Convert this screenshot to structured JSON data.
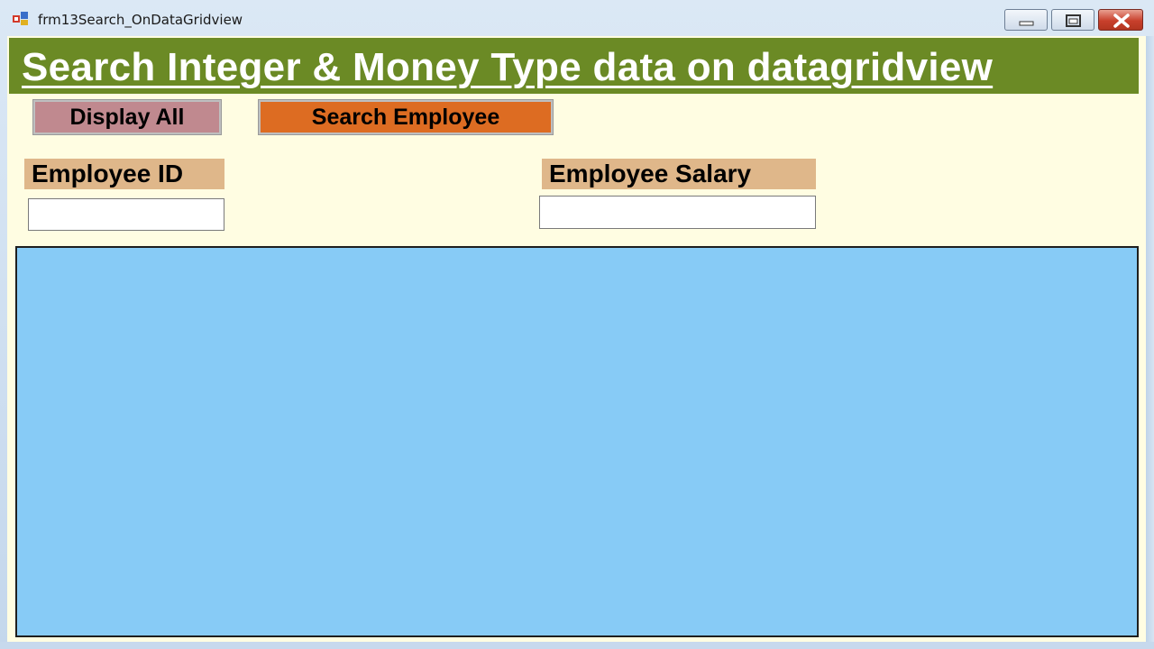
{
  "window": {
    "title": "frm13Search_OnDataGridview",
    "icon": "form-icon",
    "controls": [
      "minimize-icon",
      "maximize-icon",
      "close-icon"
    ]
  },
  "header": {
    "title": "Search Integer & Money Type data on datagridview",
    "banner_color": "#6b8a25"
  },
  "toolbar": {
    "display_all_label": "Display All",
    "search_label": "Search Employee",
    "display_all_color": "#c0898f",
    "search_color": "#dd6c22"
  },
  "filters": {
    "employee_id_label": "Employee ID",
    "employee_id_value": "",
    "employee_salary_label": "Employee Salary",
    "employee_salary_value": "",
    "label_color": "#dfb78a"
  },
  "grid": {
    "background_color": "#87cbf6",
    "rows": []
  },
  "form_background": "#fffde2"
}
